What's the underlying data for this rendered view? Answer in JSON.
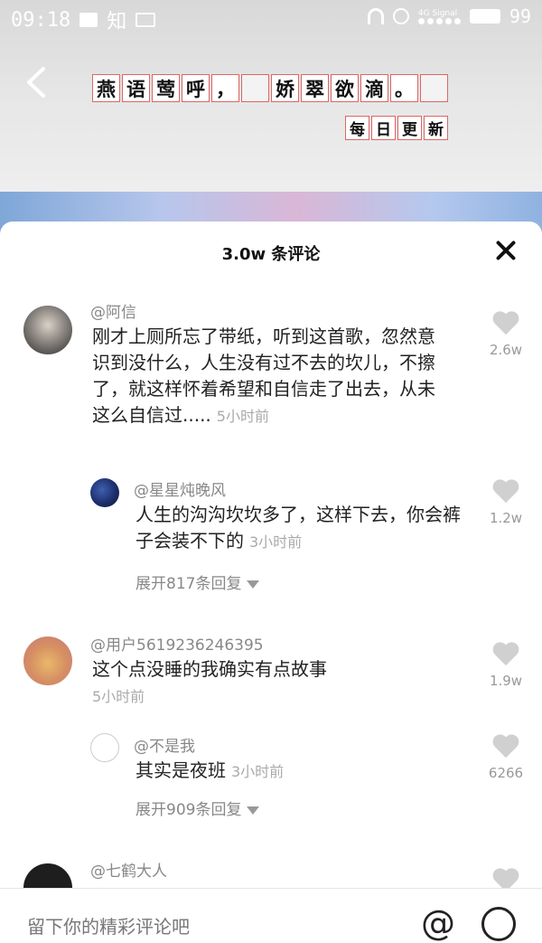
{
  "status_bar": {
    "time": "09:18",
    "app_label": "知",
    "network": "4G",
    "signal_label": "Signal",
    "battery": "99"
  },
  "video": {
    "title_chars": [
      "燕",
      "语",
      "莺",
      "呼",
      "，",
      "",
      "娇",
      "翠",
      "欲",
      "滴",
      "。",
      ""
    ],
    "subtitle_chars": [
      "每",
      "日",
      "更",
      "新"
    ]
  },
  "comments_sheet": {
    "title": "3.0w 条评论",
    "comments": [
      {
        "user": "@阿信",
        "text": "刚才上厕所忘了带纸，听到这首歌，忽然意识到没什么，人生没有过不去的坎儿，不擦了，就这样怀着希望和自信走了出去，从未这么自信过.....",
        "time": "5小时前",
        "likes": "2.6w",
        "reply": {
          "user": "@星星炖晚风",
          "text": "人生的沟沟坎坎多了，这样下去，你会裤子会装不下的",
          "time": "3小时前",
          "likes": "1.2w"
        },
        "expand": "展开817条回复"
      },
      {
        "user": "@用户5619236246395",
        "text": "这个点没睡的我确实有点故事",
        "time": "5小时前",
        "likes": "1.9w",
        "reply": {
          "user": "@不是我",
          "text": "其实是夜班",
          "time": "3小时前",
          "likes": "6266"
        },
        "expand": "展开909条回复"
      },
      {
        "user": "@七鹤大人"
      }
    ]
  },
  "input": {
    "placeholder": "留下你的精彩评论吧"
  }
}
